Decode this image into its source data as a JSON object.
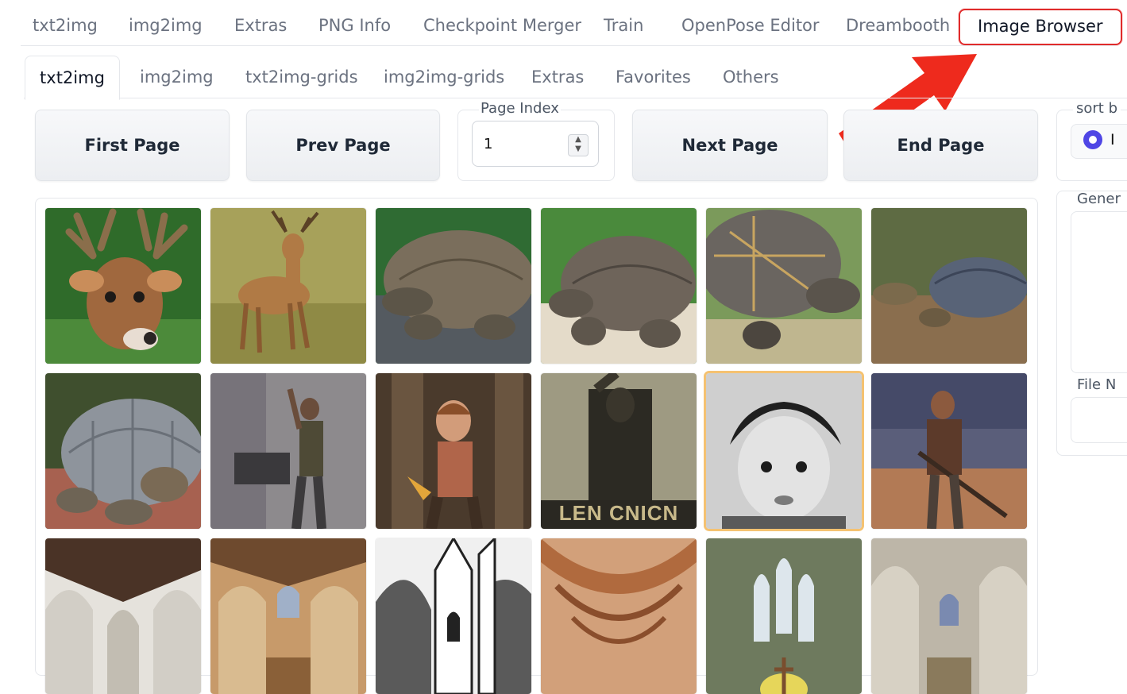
{
  "top_tabs": [
    {
      "label": "txt2img"
    },
    {
      "label": "img2img"
    },
    {
      "label": "Extras"
    },
    {
      "label": "PNG Info"
    },
    {
      "label": "Checkpoint Merger"
    },
    {
      "label": "Train"
    },
    {
      "label": "OpenPose Editor"
    },
    {
      "label": "Dreambooth"
    },
    {
      "label": "Image Browser"
    }
  ],
  "inner_tabs": [
    {
      "label": "txt2img"
    },
    {
      "label": "img2img"
    },
    {
      "label": "txt2img-grids"
    },
    {
      "label": "img2img-grids"
    },
    {
      "label": "Extras"
    },
    {
      "label": "Favorites"
    },
    {
      "label": "Others"
    }
  ],
  "controls": {
    "first_page": "First Page",
    "prev_page": "Prev Page",
    "page_index_label": "Page Index",
    "page_index_value": "1",
    "next_page": "Next Page",
    "end_page": "End Page",
    "sort_by_label": "sort b",
    "sort_option_partial": "I"
  },
  "right_panel": {
    "gen_label": "Gener",
    "file_label": "File N"
  },
  "gallery": {
    "poster_text": "LEN CNICN"
  },
  "colors": {
    "highlight_border": "#e02b2b",
    "selected_thumb": "#f5c271",
    "radio_accent": "#4f46e5",
    "arrow": "#ee2a1d"
  }
}
